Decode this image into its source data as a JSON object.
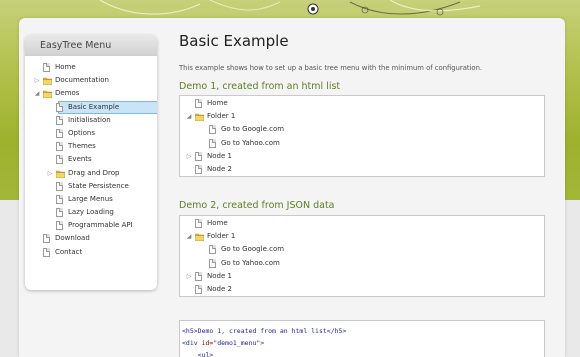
{
  "sidebar": {
    "title": "EasyTree Menu",
    "items": [
      {
        "label": "Home",
        "level": 0,
        "type": "doc",
        "toggle": ""
      },
      {
        "label": "Documentation",
        "level": 0,
        "type": "folder",
        "toggle": "▷"
      },
      {
        "label": "Demos",
        "level": 0,
        "type": "folder",
        "toggle": "◢"
      },
      {
        "label": "Basic Example",
        "level": 1,
        "type": "doc",
        "toggle": "",
        "selected": true
      },
      {
        "label": "Initialisation",
        "level": 1,
        "type": "doc",
        "toggle": ""
      },
      {
        "label": "Options",
        "level": 1,
        "type": "doc",
        "toggle": ""
      },
      {
        "label": "Themes",
        "level": 1,
        "type": "doc",
        "toggle": ""
      },
      {
        "label": "Events",
        "level": 1,
        "type": "doc",
        "toggle": ""
      },
      {
        "label": "Drag and Drop",
        "level": 1,
        "type": "folder",
        "toggle": "▷"
      },
      {
        "label": "State Persistence",
        "level": 1,
        "type": "doc",
        "toggle": ""
      },
      {
        "label": "Large Menus",
        "level": 1,
        "type": "doc",
        "toggle": ""
      },
      {
        "label": "Lazy Loading",
        "level": 1,
        "type": "doc",
        "toggle": ""
      },
      {
        "label": "Programmable API",
        "level": 1,
        "type": "doc",
        "toggle": ""
      },
      {
        "label": "Download",
        "level": 0,
        "type": "doc",
        "toggle": ""
      },
      {
        "label": "Contact",
        "level": 0,
        "type": "doc",
        "toggle": ""
      }
    ]
  },
  "main": {
    "title": "Basic Example",
    "intro": "This example shows how to set up a basic tree menu with the minimum of configuration.",
    "demo1": {
      "title": "Demo 1, created from an html list",
      "nodes": [
        {
          "label": "Home",
          "level": 0,
          "type": "doc",
          "toggle": ""
        },
        {
          "label": "Folder 1",
          "level": 0,
          "type": "folder",
          "toggle": "◢"
        },
        {
          "label": "Go to Google.com",
          "level": 1,
          "type": "doc",
          "toggle": ""
        },
        {
          "label": "Go to Yahoo.com",
          "level": 1,
          "type": "doc",
          "toggle": ""
        },
        {
          "label": "Node 1",
          "level": 0,
          "type": "doc",
          "toggle": "▷"
        },
        {
          "label": "Node 2",
          "level": 0,
          "type": "doc",
          "toggle": ""
        }
      ]
    },
    "demo2": {
      "title": "Demo 2, created from JSON data",
      "nodes": [
        {
          "label": "Home",
          "level": 0,
          "type": "doc",
          "toggle": ""
        },
        {
          "label": "Folder 1",
          "level": 0,
          "type": "folder",
          "toggle": "◢"
        },
        {
          "label": "Go to Google.com",
          "level": 1,
          "type": "doc",
          "toggle": ""
        },
        {
          "label": "Go to Yahoo.com",
          "level": 1,
          "type": "doc",
          "toggle": ""
        },
        {
          "label": "Node 1",
          "level": 0,
          "type": "doc",
          "toggle": "▷"
        },
        {
          "label": "Node 2",
          "level": 0,
          "type": "doc",
          "toggle": ""
        }
      ]
    },
    "code": {
      "line1": "<h5>Demo 1, created from an html list</h5>",
      "line2_tag_open": "<div ",
      "line2_attr": "id=",
      "line2_value": "\"demo1_menu\"",
      "line2_tag_close": ">",
      "line3": "    <ul>"
    }
  },
  "colors": {
    "accent_green": "#5e7e25",
    "header_bg_top": "#c7d07a",
    "header_bg_bottom": "#9eb22e",
    "selection_bg": "#c9e3f7",
    "selection_border": "#7fb6e2"
  }
}
